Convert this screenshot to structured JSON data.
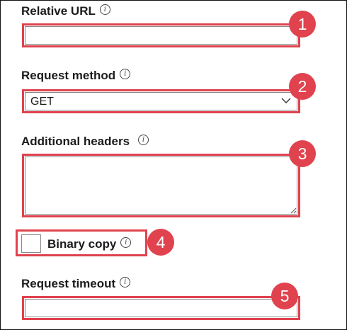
{
  "fields": {
    "relative_url": {
      "label": "Relative URL",
      "value": "",
      "badge": "1"
    },
    "request_method": {
      "label": "Request method",
      "value": "GET",
      "badge": "2"
    },
    "additional_headers": {
      "label": "Additional headers",
      "value": "",
      "badge": "3"
    },
    "binary_copy": {
      "label": "Binary copy",
      "checked": false,
      "badge": "4"
    },
    "request_timeout": {
      "label": "Request timeout",
      "value": "",
      "badge": "5"
    }
  },
  "icons": {
    "info": "i",
    "chevron": "chevron-down-icon",
    "resize": "resize-grip-icon"
  },
  "colors": {
    "highlight": "#e0424e",
    "badge_text": "#ffffff",
    "border": "#8a8886"
  }
}
